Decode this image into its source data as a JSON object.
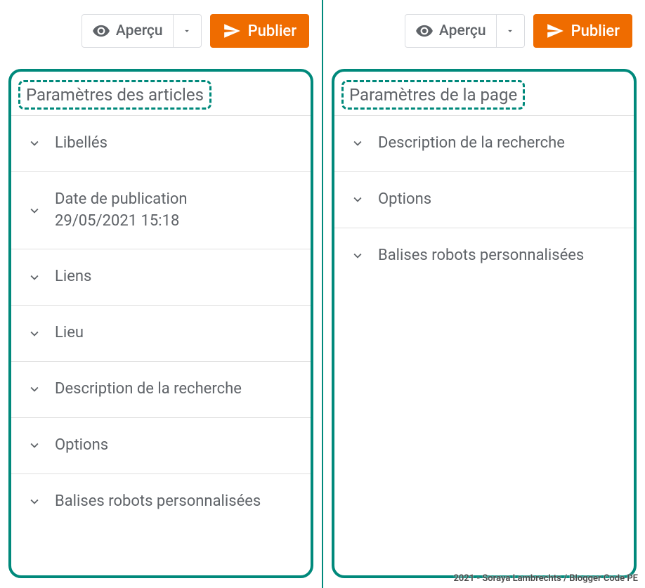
{
  "toolbar": {
    "preview_label": "Aperçu",
    "publish_label": "Publier"
  },
  "left": {
    "title": "Paramètres des articles",
    "items": [
      {
        "label": "Libellés"
      },
      {
        "label": "Date de publication",
        "sub": "29/05/2021 15:18"
      },
      {
        "label": "Liens"
      },
      {
        "label": "Lieu"
      },
      {
        "label": "Description de la recherche"
      },
      {
        "label": "Options"
      },
      {
        "label": "Balises robots personnalisées"
      }
    ]
  },
  "right": {
    "title": "Paramètres de la page",
    "items": [
      {
        "label": "Description de la recherche"
      },
      {
        "label": "Options"
      },
      {
        "label": "Balises robots personnalisées"
      }
    ]
  },
  "credit": "2021 - Soraya Lambrechts / Blogger Code PE"
}
